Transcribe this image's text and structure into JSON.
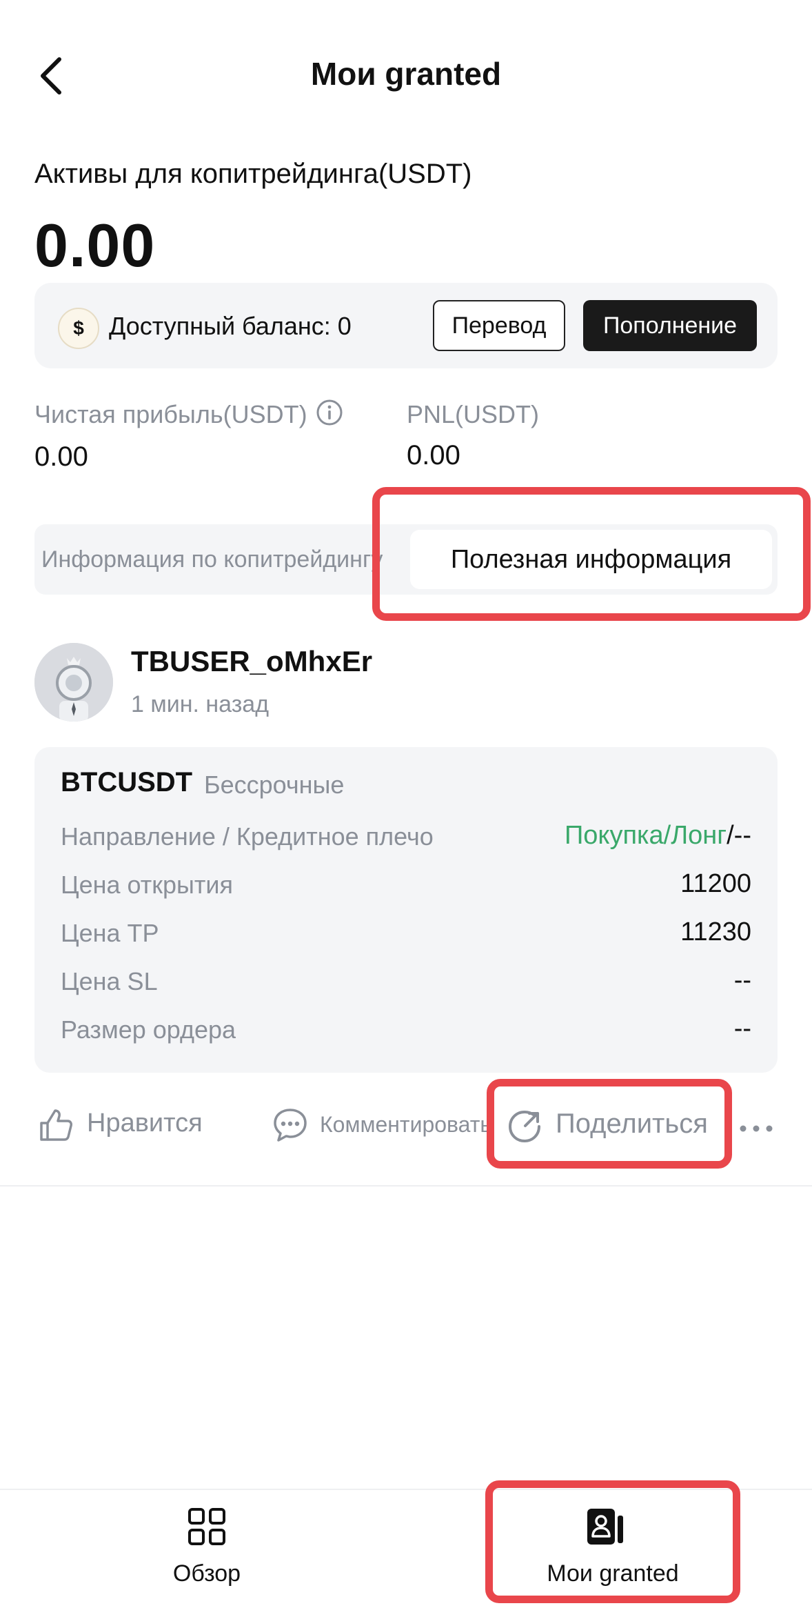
{
  "header": {
    "title": "Мои granted",
    "back_icon": "chevron-left-icon"
  },
  "assets": {
    "label": "Активы для копитрейдинга(USDT)",
    "value": "0.00"
  },
  "balance": {
    "coin_symbol": "$",
    "text": "Доступный баланс: 0",
    "transfer_label": "Перевод",
    "deposit_label": "Пополнение"
  },
  "stats": {
    "net_profit_label": "Чистая прибыль(USDT)",
    "net_profit_value": "0.00",
    "pnl_label": "PNL(USDT)",
    "pnl_value": "0.00"
  },
  "tabs": {
    "left": "Информация по копитрейдингу",
    "right": "Полезная информация",
    "active": "right"
  },
  "post": {
    "username": "TBUSER_oMhxEr",
    "time": "1 мин. назад",
    "symbol": "BTCUSDT",
    "contract_type": "Бессрочные",
    "rows": [
      {
        "label": "Направление / Кредитное плечо",
        "value_accent": "Покупка/Лонг",
        "value": "/--"
      },
      {
        "label": "Цена открытия",
        "value": "11200"
      },
      {
        "label": "Цена TP",
        "value": "11230"
      },
      {
        "label": "Цена SL",
        "value": "--"
      },
      {
        "label": "Размер ордера",
        "value": "--"
      }
    ],
    "actions": {
      "like": "Нравится",
      "comment": "Комментировать",
      "share": "Поделиться"
    }
  },
  "bottom_nav": {
    "overview": "Обзор",
    "my_copy": "Мои granted"
  },
  "colors": {
    "accent_green": "#3aa86a",
    "highlight_red": "#e9464b",
    "dark_button": "#1a1a1a"
  }
}
